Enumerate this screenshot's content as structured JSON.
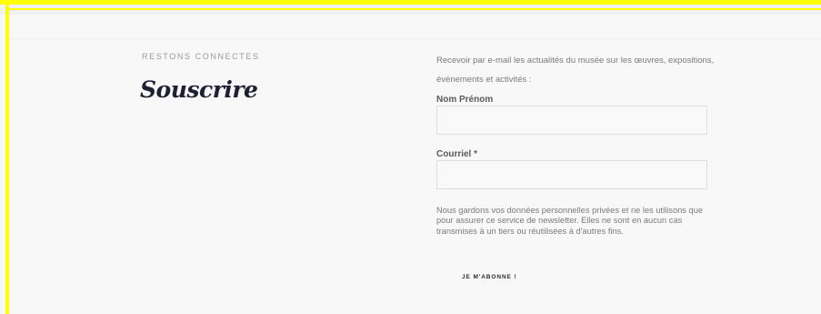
{
  "subscribe": {
    "kicker": "RESTONS CONNECTES",
    "title": "Souscrire",
    "intro": "Recevoir par e-mail les actualités du musée sur les œuvres, expositions, événements et activités :",
    "name_label": "Nom Prénom",
    "name_value": "",
    "email_label": "Courriel *",
    "email_value": "",
    "privacy": "Nous gardons vos données personnelles privées et ne les utilisons que pour assurer ce service de newsletter. Elles ne sont en aucun cas transmises à un tiers ou réutilisées à d'autres fins.",
    "submit_label": "JE M'ABONNE !"
  },
  "colors": {
    "highlight": "#ffff00",
    "background": "#f8f8f8",
    "title": "#1d2033",
    "muted_text": "#7a7a7a"
  }
}
